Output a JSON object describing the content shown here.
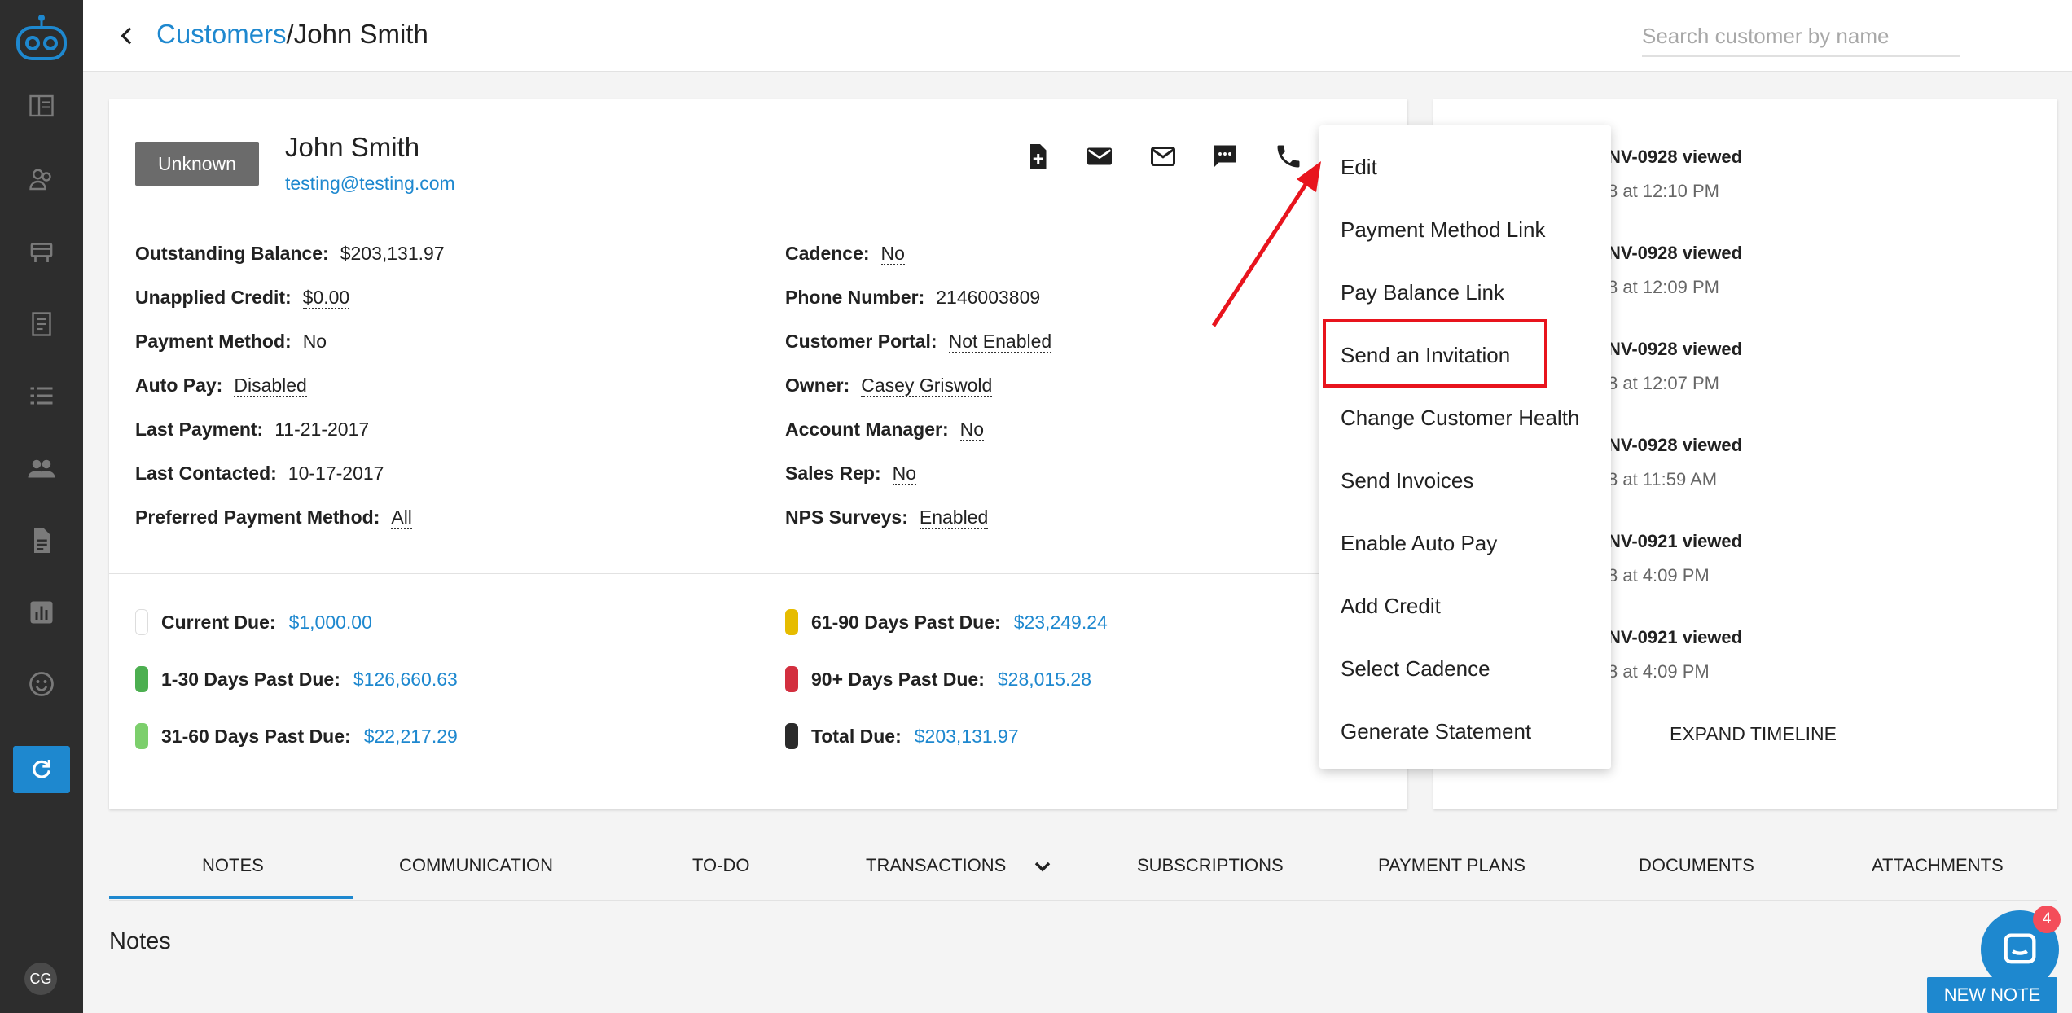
{
  "header": {
    "breadcrumb_parent": "Customers",
    "breadcrumb_sep": "/",
    "breadcrumb_current": "John Smith",
    "search_placeholder": "Search customer by name"
  },
  "sidebar": {
    "items": [
      "dashboard-icon",
      "customers-icon",
      "payments-icon",
      "invoices-icon",
      "list-icon",
      "people-icon",
      "document-icon",
      "reports-icon",
      "smiley-icon"
    ],
    "refresh_icon": "refresh-icon",
    "avatar_initials": "CG"
  },
  "customer": {
    "status": "Unknown",
    "name": "John Smith",
    "email": "testing@testing.com"
  },
  "actions": [
    "new-document-icon",
    "email-icon",
    "email-outline-icon",
    "sms-icon",
    "phone-icon"
  ],
  "fields_left": [
    {
      "label": "Outstanding Balance:",
      "value": "$203,131.97"
    },
    {
      "label": "Unapplied Credit:",
      "value": "$0.00"
    },
    {
      "label": "Payment Method:",
      "value": "No"
    },
    {
      "label": "Auto Pay:",
      "value": "Disabled"
    },
    {
      "label": "Last Payment:",
      "value": "11-21-2017"
    },
    {
      "label": "Last Contacted:",
      "value": "10-17-2017"
    },
    {
      "label": "Preferred Payment Method:",
      "value": "All"
    }
  ],
  "fields_right": [
    {
      "label": "Cadence:",
      "value": "No"
    },
    {
      "label": "Phone Number:",
      "value": "2146003809"
    },
    {
      "label": "Customer Portal:",
      "value": "Not Enabled"
    },
    {
      "label": "Owner:",
      "value": "Casey Griswold"
    },
    {
      "label": "Account Manager:",
      "value": "No"
    },
    {
      "label": "Sales Rep:",
      "value": "No"
    },
    {
      "label": "NPS Surveys:",
      "value": "Enabled"
    }
  ],
  "aging": [
    {
      "label": "Current Due:",
      "amount": "$1,000.00",
      "color": "#ffffff"
    },
    {
      "label": "1-30 Days Past Due:",
      "amount": "$126,660.63",
      "color": "#4caf50"
    },
    {
      "label": "31-60 Days Past Due:",
      "amount": "$22,217.29",
      "color": "#7ccf6c"
    },
    {
      "label": "61-90 Days Past Due:",
      "amount": "$23,249.24",
      "color": "#e6bc00"
    },
    {
      "label": "90+ Days Past Due:",
      "amount": "$28,015.28",
      "color": "#d32f3f"
    },
    {
      "label": "Total Due:",
      "amount": "$203,131.97",
      "color": "#2b2b2b"
    }
  ],
  "timeline": {
    "events": [
      {
        "title": "NV-0928 viewed",
        "time": "8 at 12:10 PM"
      },
      {
        "title": "NV-0928 viewed",
        "time": "8 at 12:09 PM"
      },
      {
        "title": "NV-0928 viewed",
        "time": "8 at 12:07 PM"
      },
      {
        "title": "NV-0928 viewed",
        "time": "8 at 11:59 AM"
      },
      {
        "title": "NV-0921 viewed",
        "time": "8 at 4:09 PM"
      },
      {
        "title": "NV-0921 viewed",
        "time": "8 at 4:09 PM"
      }
    ],
    "expand_label": "EXPAND TIMELINE"
  },
  "menu": {
    "items": [
      "Edit",
      "Payment Method Link",
      "Pay Balance Link",
      "Send an Invitation",
      "Change Customer Health",
      "Send Invoices",
      "Enable Auto Pay",
      "Add Credit",
      "Select Cadence",
      "Generate Statement"
    ],
    "highlighted": "Send an Invitation"
  },
  "tabs": [
    "NOTES",
    "COMMUNICATION",
    "TO-DO",
    "TRANSACTIONS",
    "SUBSCRIPTIONS",
    "PAYMENT PLANS",
    "DOCUMENTS",
    "ATTACHMENTS"
  ],
  "notes": {
    "title": "Notes",
    "new_note_label": "NEW NOTE"
  },
  "chat": {
    "badge_count": "4"
  },
  "colors": {
    "accent": "#1e88cf",
    "sidebar": "#2d2d2d",
    "highlight": "#e8141d"
  }
}
